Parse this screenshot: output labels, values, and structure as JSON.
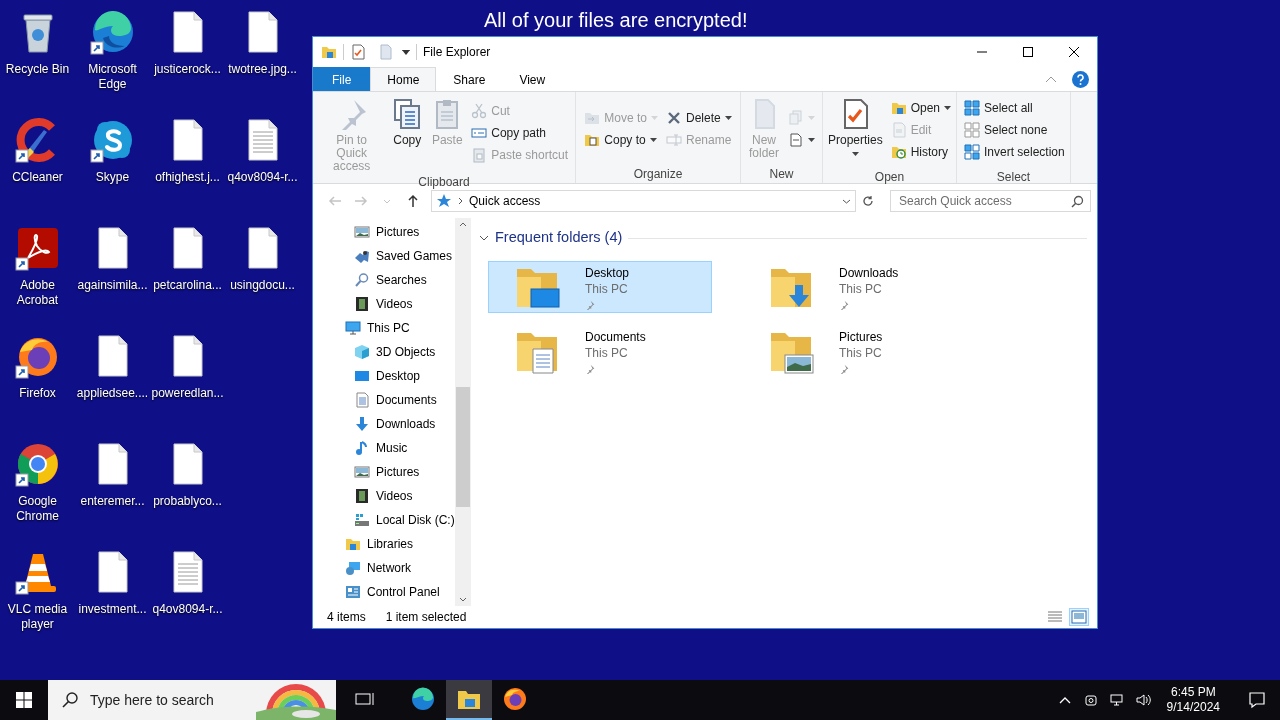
{
  "background_text": "All of your files are encrypted!",
  "desktop_icons": [
    {
      "label": "Recycle Bin",
      "kind": "bin",
      "shortcut": false
    },
    {
      "label": "CCleaner",
      "kind": "cleaner",
      "shortcut": true
    },
    {
      "label": "Adobe Acrobat",
      "kind": "pdf",
      "shortcut": true
    },
    {
      "label": "Firefox",
      "kind": "firefox",
      "shortcut": true
    },
    {
      "label": "Google Chrome",
      "kind": "chrome",
      "shortcut": true
    },
    {
      "label": "VLC media player",
      "kind": "vlc",
      "shortcut": true
    },
    {
      "label": "Microsoft Edge",
      "kind": "edge",
      "shortcut": true
    },
    {
      "label": "Skype",
      "kind": "skype",
      "shortcut": true
    },
    {
      "label": "againsimila...",
      "kind": "file",
      "shortcut": false
    },
    {
      "label": "appliedsee....",
      "kind": "file",
      "shortcut": false
    },
    {
      "label": "enteremer...",
      "kind": "file",
      "shortcut": false
    },
    {
      "label": "investment...",
      "kind": "file",
      "shortcut": false
    },
    {
      "label": "justicerock...",
      "kind": "file",
      "shortcut": false
    },
    {
      "label": "ofhighest.j...",
      "kind": "file",
      "shortcut": false
    },
    {
      "label": "petcarolina...",
      "kind": "file",
      "shortcut": false
    },
    {
      "label": "poweredlan...",
      "kind": "file",
      "shortcut": false
    },
    {
      "label": "probablyco...",
      "kind": "file",
      "shortcut": false
    },
    {
      "label": "q4ov8094-r...",
      "kind": "textfile",
      "shortcut": false
    },
    {
      "label": "twotree.jpg...",
      "kind": "file",
      "shortcut": false
    },
    {
      "label": "q4ov8094-r...",
      "kind": "textfile",
      "shortcut": false
    },
    {
      "label": "usingdocu...",
      "kind": "file",
      "shortcut": false
    }
  ],
  "window": {
    "title": "File Explorer",
    "tabs": [
      {
        "label": "File",
        "kind": "file",
        "selected": false
      },
      {
        "label": "Home",
        "kind": "tab",
        "selected": true
      },
      {
        "label": "Share",
        "kind": "tab",
        "selected": false
      },
      {
        "label": "View",
        "kind": "tab",
        "selected": false
      }
    ],
    "ribbon": [
      {
        "label": "Clipboard",
        "items": [
          {
            "kind": "large",
            "label": "Pin to Quick access",
            "disabled": true,
            "dropdown": false
          },
          {
            "kind": "large",
            "label": "Copy",
            "disabled": false,
            "dropdown": false
          },
          {
            "kind": "large",
            "label": "Paste",
            "disabled": true,
            "dropdown": false
          },
          {
            "kind": "stack",
            "commands": [
              {
                "kind": "small",
                "label": "Cut",
                "disabled": true,
                "dropdown": false
              },
              {
                "kind": "small",
                "label": "Copy path",
                "disabled": false,
                "dropdown": false
              },
              {
                "kind": "small",
                "label": "Paste shortcut",
                "disabled": true,
                "dropdown": false
              }
            ]
          }
        ]
      },
      {
        "label": "Organize",
        "items": [
          {
            "kind": "stack",
            "commands": [
              {
                "kind": "small",
                "label": "Move to",
                "disabled": true,
                "dropdown": true
              },
              {
                "kind": "small",
                "label": "Copy to",
                "disabled": false,
                "dropdown": true
              }
            ]
          },
          {
            "kind": "stack",
            "commands": [
              {
                "kind": "small",
                "label": "Delete",
                "disabled": false,
                "dropdown": true
              },
              {
                "kind": "small",
                "label": "Rename",
                "disabled": true,
                "dropdown": false
              }
            ]
          }
        ]
      },
      {
        "label": "New",
        "items": [
          {
            "kind": "large",
            "label": "New folder",
            "disabled": true,
            "dropdown": false
          },
          {
            "kind": "stack",
            "commands": [
              {
                "kind": "icon",
                "disabled": true,
                "dropdown": true
              },
              {
                "kind": "icon",
                "disabled": false,
                "dropdown": true
              }
            ]
          }
        ]
      },
      {
        "label": "Open",
        "items": [
          {
            "kind": "large",
            "label": "Properties",
            "disabled": false,
            "dropdown": true
          },
          {
            "kind": "stack",
            "commands": [
              {
                "kind": "small",
                "label": "Open",
                "disabled": false,
                "dropdown": true
              },
              {
                "kind": "small",
                "label": "Edit",
                "disabled": true,
                "dropdown": false
              },
              {
                "kind": "small",
                "label": "History",
                "disabled": false,
                "dropdown": false
              }
            ]
          }
        ]
      },
      {
        "label": "Select",
        "items": [
          {
            "kind": "stack",
            "commands": [
              {
                "kind": "small",
                "label": "Select all",
                "disabled": false,
                "dropdown": false
              },
              {
                "kind": "small",
                "label": "Select none",
                "disabled": false,
                "dropdown": false
              },
              {
                "kind": "small",
                "label": "Invert selection",
                "disabled": false,
                "dropdown": false
              }
            ]
          }
        ]
      }
    ],
    "nav_buttons": [
      {
        "kind": "back",
        "disabled": true
      },
      {
        "kind": "forward",
        "disabled": true
      },
      {
        "kind": "recent",
        "disabled": true
      },
      {
        "kind": "up",
        "disabled": false
      }
    ],
    "address": {
      "path": "Quick access"
    },
    "search": {
      "placeholder": "Search Quick access"
    },
    "nav_pane": {
      "scrolled_children": [
        {
          "label": "Pictures",
          "kind": "pictures"
        },
        {
          "label": "Saved Games",
          "kind": "games"
        },
        {
          "label": "Searches",
          "kind": "search"
        },
        {
          "label": "Videos",
          "kind": "videos"
        }
      ],
      "items": [
        {
          "label": "This PC",
          "kind": "pc",
          "children": [
            {
              "label": "3D Objects",
              "kind": "objects"
            },
            {
              "label": "Desktop",
              "kind": "desktop"
            },
            {
              "label": "Documents",
              "kind": "documents"
            },
            {
              "label": "Downloads",
              "kind": "downloads"
            },
            {
              "label": "Music",
              "kind": "music"
            },
            {
              "label": "Pictures",
              "kind": "pictures"
            },
            {
              "label": "Videos",
              "kind": "videos"
            },
            {
              "label": "Local Disk (C:)",
              "kind": "drive"
            }
          ]
        },
        {
          "label": "Libraries",
          "kind": "libraries"
        },
        {
          "label": "Network",
          "kind": "network"
        },
        {
          "label": "Control Panel",
          "kind": "control"
        }
      ]
    },
    "content": {
      "section": {
        "label": "Frequent folders (4)",
        "expanded": true
      },
      "folders": [
        {
          "name": "Desktop",
          "location": "This PC",
          "kind": "desktop",
          "pinned": true,
          "selected": true
        },
        {
          "name": "Downloads",
          "location": "This PC",
          "kind": "downloads",
          "pinned": true,
          "selected": false
        },
        {
          "name": "Documents",
          "location": "This PC",
          "kind": "documents",
          "pinned": true,
          "selected": false
        },
        {
          "name": "Pictures",
          "location": "This PC",
          "kind": "pictures",
          "pinned": true,
          "selected": false
        }
      ]
    },
    "status_bar": {
      "count": "4 items",
      "selection": "1 item selected",
      "view_buttons": [
        {
          "kind": "details",
          "selected": false
        },
        {
          "kind": "tiles",
          "selected": true
        }
      ]
    }
  },
  "taskbar": {
    "search": {
      "placeholder": "Type here to search"
    },
    "apps": [
      {
        "kind": "taskview",
        "active": false
      },
      {
        "kind": "edge",
        "active": false
      },
      {
        "kind": "explorer",
        "active": true
      },
      {
        "kind": "firefox",
        "active": false
      }
    ],
    "time": "6:45 PM",
    "date": "9/14/2024"
  }
}
